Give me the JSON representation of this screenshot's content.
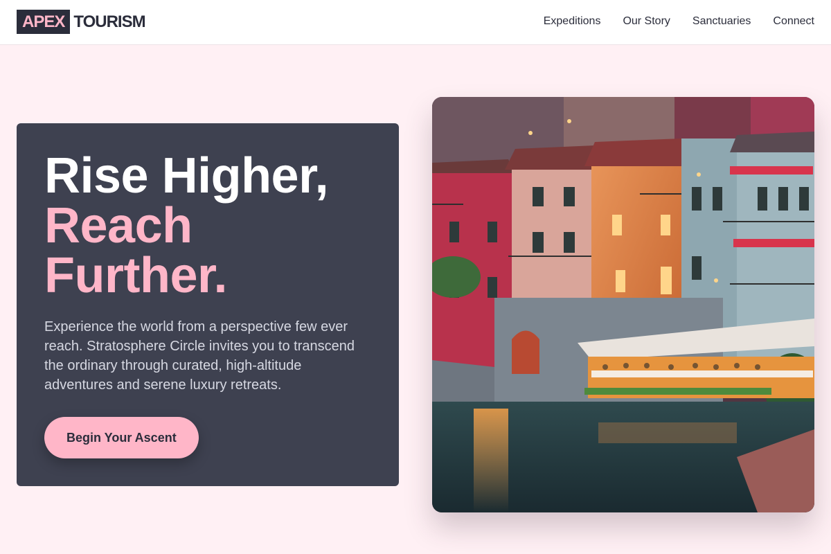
{
  "header": {
    "logo_box": "APEX",
    "logo_text": "TOURISM",
    "nav": [
      "Expeditions",
      "Our Story",
      "Sanctuaries",
      "Connect"
    ]
  },
  "hero": {
    "line1": "Rise Higher,",
    "line2": "Reach",
    "line3": "Further.",
    "description": "Experience the world from a perspective few ever reach. Stratosphere Circle invites you to transcend the ordinary through curated, high-altitude adventures and serene luxury retreats.",
    "cta": "Begin Your Ascent"
  },
  "colors": {
    "page_bg": "#FFF0F4",
    "dark": "#2B2D3B",
    "card": "#3E4150",
    "accent_pink": "#FFB6C8"
  },
  "image": {
    "subject": "lakeside-village-photo"
  }
}
